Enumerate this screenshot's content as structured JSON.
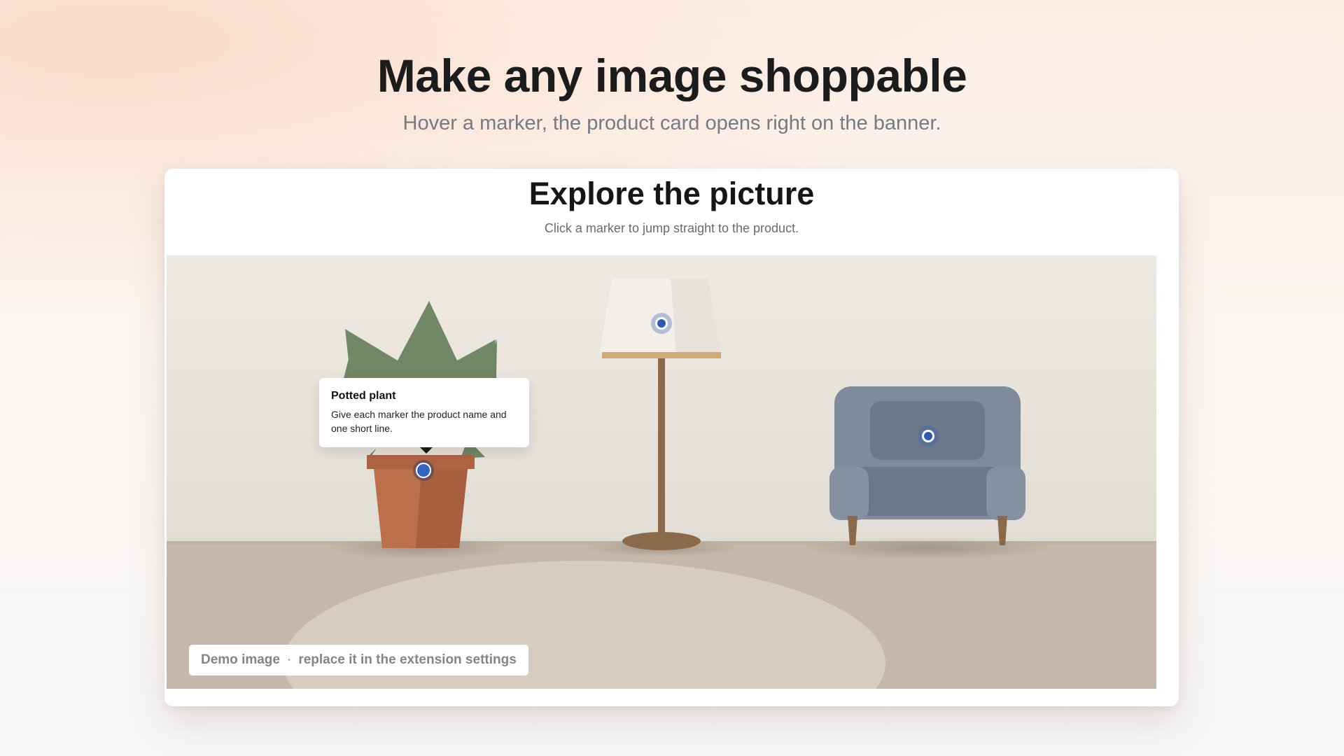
{
  "hero": {
    "title": "Make any image shoppable",
    "subtitle": "Hover a marker, the product card opens right on the banner."
  },
  "card": {
    "title": "Explore the picture",
    "subtitle": "Click a marker to jump straight to the product."
  },
  "scene": {
    "objects": [
      "potted-plant",
      "floor-lamp",
      "armchair",
      "rug"
    ],
    "colors": {
      "wall": "#e6e1d9",
      "floor": "#c5b8aa",
      "rug": "#d6ccc0",
      "plant_leaves": "#718766",
      "pot": "#b96e4a",
      "lamp_wood": "#8a6a4a",
      "armchair": "#7f8a9b",
      "marker": "#2f5ab0"
    }
  },
  "markers": [
    {
      "product": "Potted plant",
      "state": "active"
    },
    {
      "product": "Floor lamp",
      "state": "idle"
    },
    {
      "product": "Armchair",
      "state": "idle"
    }
  ],
  "tooltip": {
    "title": "Potted plant",
    "text": "Give each marker the product name and one short line."
  },
  "badge": {
    "part1": "Demo image",
    "separator": "·",
    "part2": "replace it in the extension settings"
  }
}
